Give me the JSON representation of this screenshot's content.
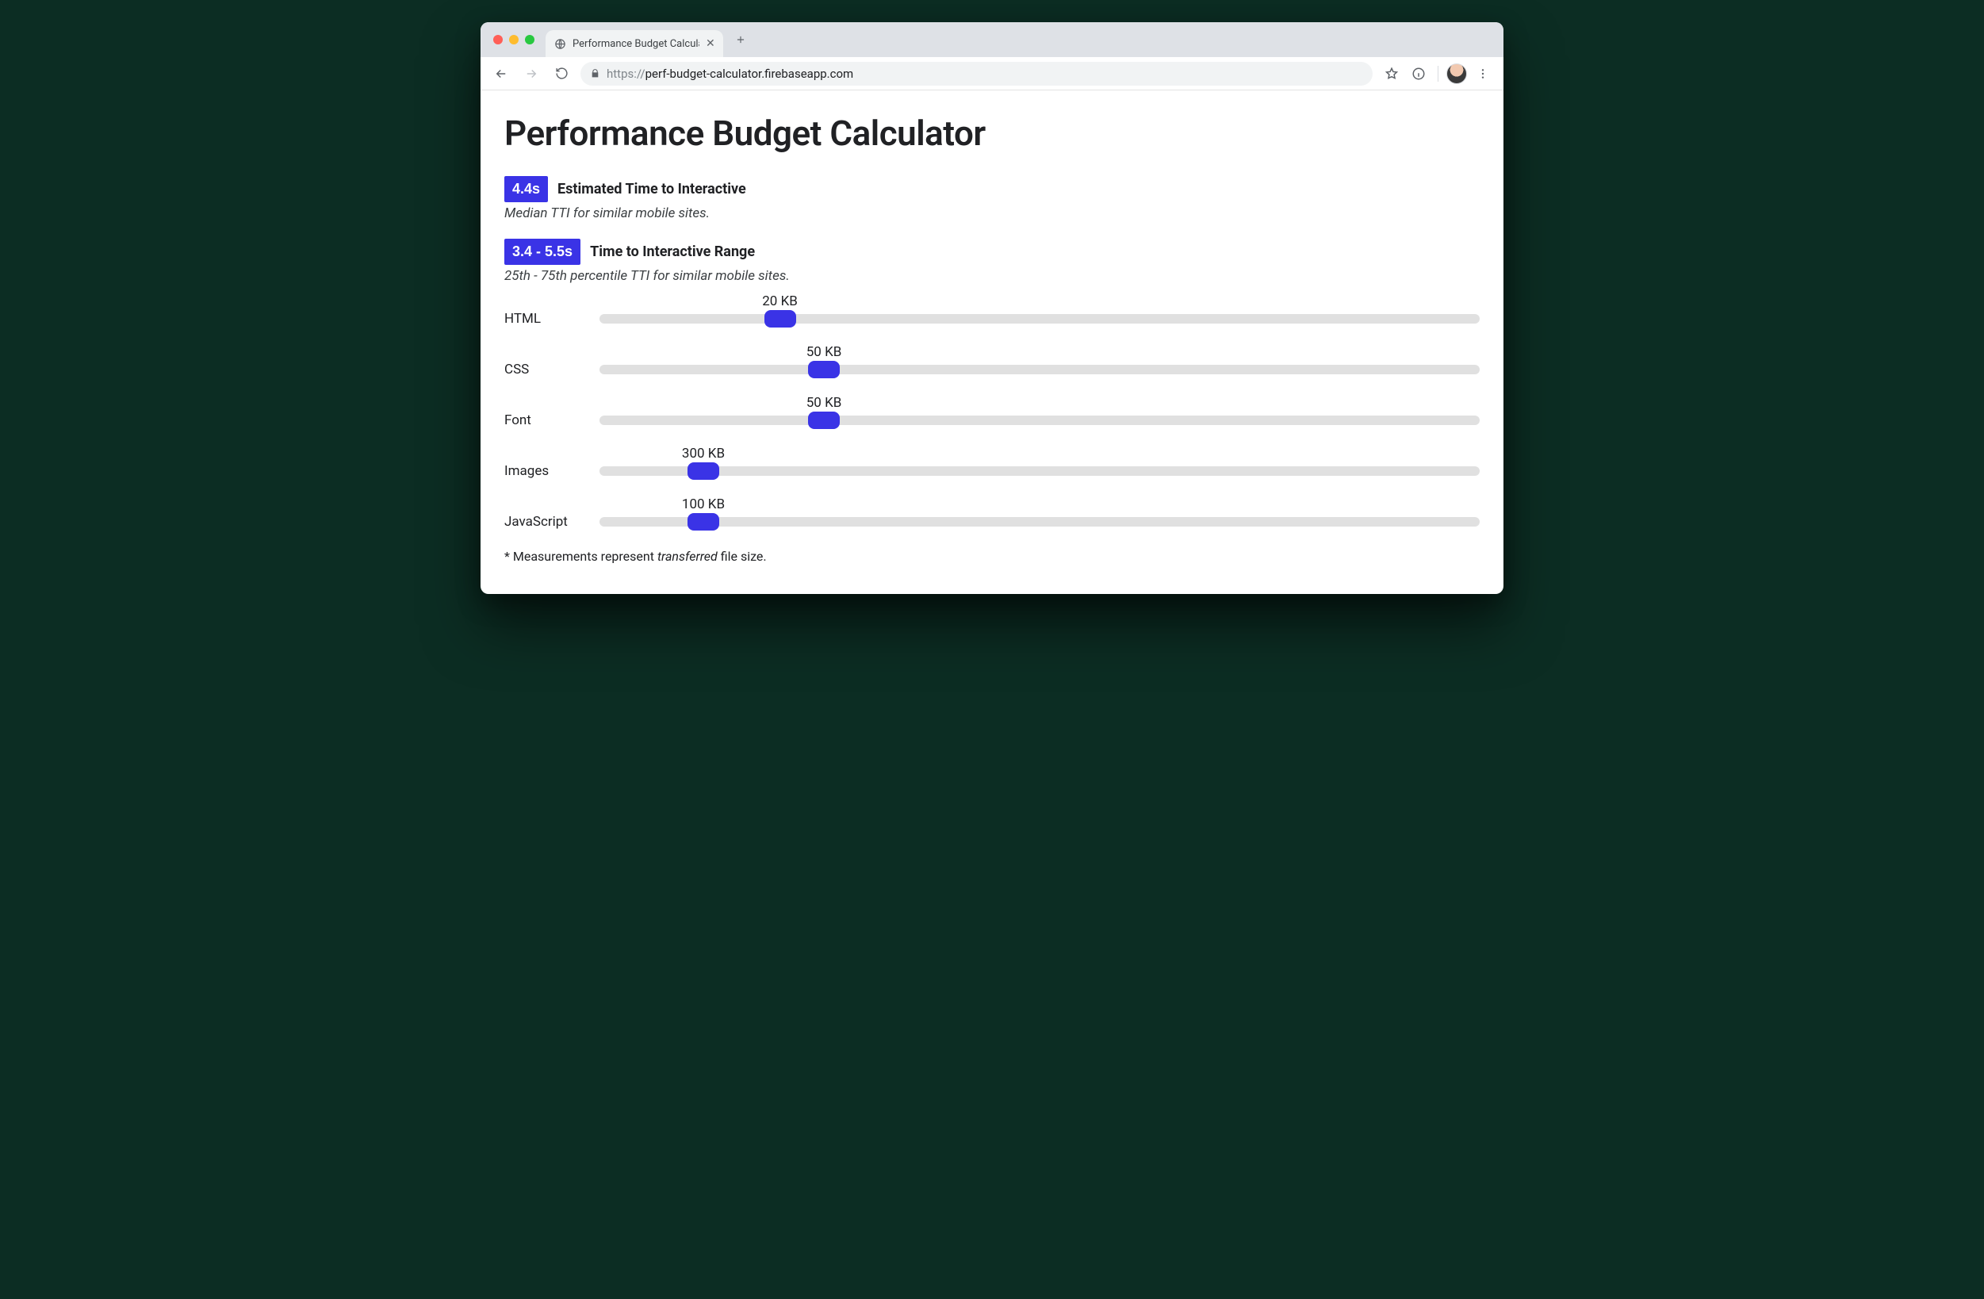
{
  "browser": {
    "tab_title": "Performance Budget Calculato",
    "url_scheme": "https://",
    "url_host": "perf-budget-calculator.firebaseapp.com"
  },
  "page": {
    "title": "Performance Budget Calculator",
    "tti": {
      "badge": "4.4s",
      "label": "Estimated Time to Interactive",
      "sub": "Median TTI for similar mobile sites."
    },
    "tti_range": {
      "badge": "3.4 - 5.5s",
      "label": "Time to Interactive Range",
      "sub": "25th - 75th percentile TTI for similar mobile sites."
    },
    "sliders": [
      {
        "label": "HTML",
        "value": 20,
        "value_text": "20 KB",
        "thumb_pct": 20.5
      },
      {
        "label": "CSS",
        "value": 50,
        "value_text": "50 KB",
        "thumb_pct": 25.5
      },
      {
        "label": "Font",
        "value": 50,
        "value_text": "50 KB",
        "thumb_pct": 25.5
      },
      {
        "label": "Images",
        "value": 300,
        "value_text": "300 KB",
        "thumb_pct": 11.8
      },
      {
        "label": "JavaScript",
        "value": 100,
        "value_text": "100 KB",
        "thumb_pct": 11.8
      }
    ],
    "footnote_prefix": "* Measurements represent ",
    "footnote_em": "transferred",
    "footnote_suffix": " file size."
  },
  "colors": {
    "accent": "#3a33e6"
  }
}
